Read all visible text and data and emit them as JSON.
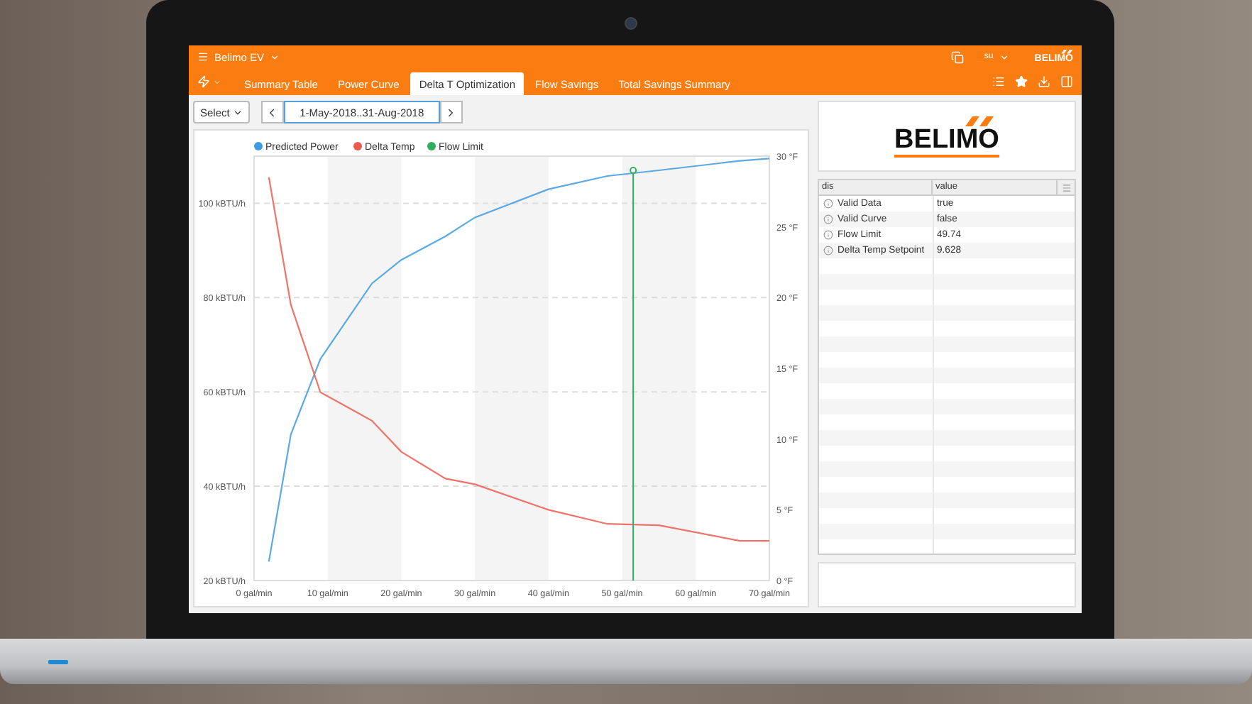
{
  "app": {
    "title": "Belimo EV",
    "user": "su",
    "brand": "BELIMO"
  },
  "tabs": [
    {
      "label": "Summary Table",
      "selected": false
    },
    {
      "label": "Power Curve",
      "selected": false
    },
    {
      "label": "Delta T Optimization",
      "selected": true
    },
    {
      "label": "Flow Savings",
      "selected": false
    },
    {
      "label": "Total Savings Summary",
      "selected": false
    }
  ],
  "toolbar": {
    "select": "Select",
    "date_range": "1-May-2018..31-Aug-2018"
  },
  "chart": {
    "chart_data": {
      "type": "line",
      "x": [
        2,
        5,
        9,
        16,
        20,
        26,
        30,
        40,
        48,
        55,
        66,
        70
      ],
      "series": [
        {
          "name": "Predicted Power",
          "color": "#3f9be0",
          "values": [
            24,
            51,
            67,
            83,
            88,
            93,
            97,
            103,
            105.8,
            107,
            109,
            109.5
          ]
        },
        {
          "name": "Delta Temp",
          "color": "#ec5a4f",
          "axis": "y2",
          "values": [
            28.5,
            19.5,
            13.3,
            11.3,
            9.1,
            7.2,
            6.8,
            5.0,
            4.0,
            3.9,
            2.8,
            2.8
          ]
        }
      ],
      "grid": true,
      "legend": "top",
      "xlim": [
        0,
        70
      ],
      "ylim": [
        20,
        110
      ],
      "y2lim": [
        0,
        30
      ],
      "xticks": [
        {
          "value": 0,
          "label": "0 gal/min"
        },
        {
          "value": 10,
          "label": "10 gal/min"
        },
        {
          "value": 20,
          "label": "20 gal/min"
        },
        {
          "value": 30,
          "label": "30 gal/min"
        },
        {
          "value": 40,
          "label": "40 gal/min"
        },
        {
          "value": 50,
          "label": "50 gal/min"
        },
        {
          "value": 60,
          "label": "60 gal/min"
        },
        {
          "value": 70,
          "label": "70 gal/min"
        }
      ],
      "yticks": [
        {
          "value": 20,
          "label": "20 kBTU/h"
        },
        {
          "value": 40,
          "label": "40 kBTU/h"
        },
        {
          "value": 60,
          "label": "60 kBTU/h"
        },
        {
          "value": 80,
          "label": "80 kBTU/h"
        },
        {
          "value": 100,
          "label": "100 kBTU/h"
        }
      ],
      "y2ticks": [
        {
          "value": 0,
          "label": "0 °F"
        },
        {
          "value": 5,
          "label": "5 °F"
        },
        {
          "value": 10,
          "label": "10 °F"
        },
        {
          "value": 15,
          "label": "15 °F"
        },
        {
          "value": 20,
          "label": "20 °F"
        },
        {
          "value": 25,
          "label": "25 °F"
        },
        {
          "value": 30,
          "label": "30 °F"
        }
      ],
      "ref_lines": [
        {
          "axis": "x",
          "value": 51.5,
          "label": "Flow Limit",
          "color": "#2fae5e"
        }
      ]
    }
  },
  "logo": {
    "text": "BELIMO"
  },
  "table": {
    "columns": [
      "dis",
      "value"
    ],
    "rows": [
      {
        "dis": "Valid Data",
        "value": "true"
      },
      {
        "dis": "Valid Curve",
        "value": "false"
      },
      {
        "dis": "Flow Limit",
        "value": "49.74"
      },
      {
        "dis": "Delta Temp Setpoint",
        "value": "9.628"
      }
    ]
  }
}
